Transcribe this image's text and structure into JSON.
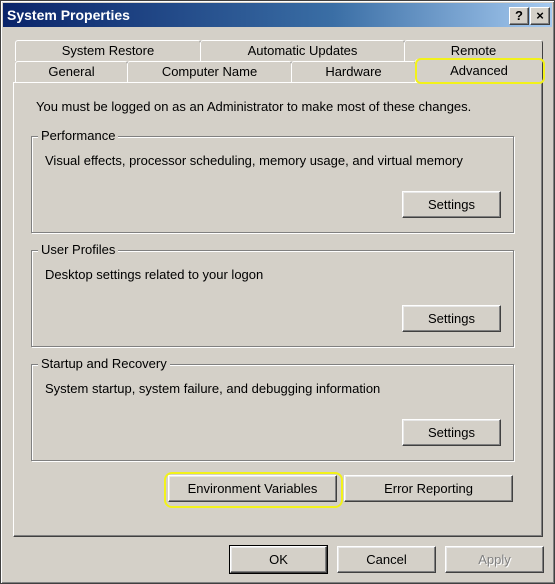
{
  "window": {
    "title": "System Properties",
    "help_button": "?",
    "close_button": "×"
  },
  "tabs": {
    "row_back": [
      "System Restore",
      "Automatic Updates",
      "Remote"
    ],
    "row_front": [
      "General",
      "Computer Name",
      "Hardware",
      "Advanced"
    ],
    "active": "Advanced"
  },
  "advanced": {
    "admin_note": "You must be logged on as an Administrator to make most of these changes.",
    "performance": {
      "title": "Performance",
      "description": "Visual effects, processor scheduling, memory usage, and virtual memory",
      "settings_label": "Settings"
    },
    "user_profiles": {
      "title": "User Profiles",
      "description": "Desktop settings related to your logon",
      "settings_label": "Settings"
    },
    "startup_recovery": {
      "title": "Startup and Recovery",
      "description": "System startup, system failure, and debugging information",
      "settings_label": "Settings"
    },
    "environment_variables_label": "Environment Variables",
    "error_reporting_label": "Error Reporting"
  },
  "footer": {
    "ok_label": "OK",
    "cancel_label": "Cancel",
    "apply_label": "Apply"
  },
  "colors": {
    "face": "#d4d0c8",
    "title_start": "#0a246a",
    "title_end": "#a6caf0",
    "highlight": "#f2f21a"
  }
}
